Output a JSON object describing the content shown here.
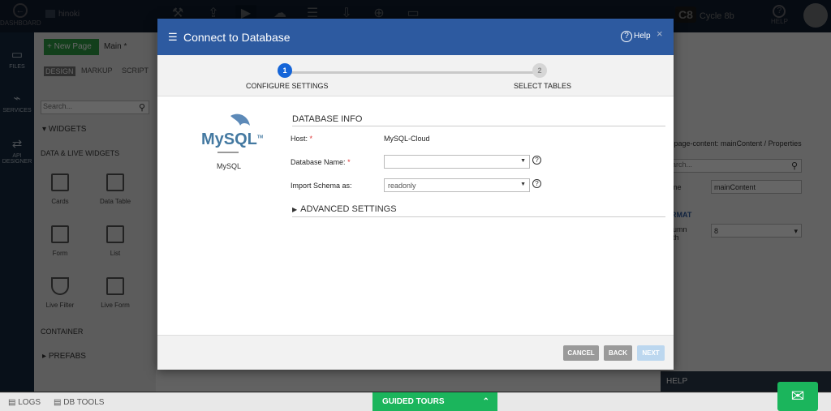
{
  "topbar": {
    "dashboard_label": "DASHBOARD",
    "project_name": "hinoki",
    "cycle_badge": "C8",
    "cycle_name": "Cycle 8b",
    "help_label": "HELP"
  },
  "leftnav": {
    "items": [
      {
        "label": "FILES",
        "icon": "folder-icon"
      },
      {
        "label": "SERVICES",
        "icon": "plug-icon"
      },
      {
        "label": "API DESIGNER",
        "icon": "api-icon"
      }
    ]
  },
  "widgets_panel": {
    "page_tab": "Main",
    "new_page_label": "New Page",
    "tabs": [
      "DESIGN",
      "MARKUP",
      "SCRIPT"
    ],
    "search_placeholder": "Search...",
    "widgets_header": "WIDGETS",
    "section_data_live": "DATA & LIVE WIDGETS",
    "items": [
      "Cards",
      "Data Table",
      "Form",
      "List",
      "Live Filter",
      "Live Form"
    ],
    "section_container": "CONTAINER",
    "prefabs_label": "PREFABS"
  },
  "right_panel": {
    "breadcrumb": "m-page-content: mainContent / Properties",
    "search_placeholder": "earch...",
    "name_label": "ame",
    "name_value": "mainContent",
    "format_header": "ORMAT",
    "column_width_label": "olumn idth",
    "column_width_value": "8",
    "help_label": "HELP"
  },
  "bottombar": {
    "logs_label": "LOGS",
    "dbtools_label": "DB TOOLS",
    "guided_tours_label": "GUIDED TOURS"
  },
  "modal": {
    "title": "Connect to Database",
    "help_label": "Help",
    "close_label": "×",
    "steps": [
      {
        "number": "1",
        "label": "CONFIGURE SETTINGS",
        "active": true
      },
      {
        "number": "2",
        "label": "SELECT TABLES",
        "active": false
      }
    ],
    "db_logo_text": "MySQL",
    "db_logo_sub": "TM",
    "db_name": "MySQL",
    "section_title": "DATABASE INFO",
    "host_label": "Host:",
    "host_value": "MySQL-Cloud",
    "database_name_label": "Database Name:",
    "database_name_value": "",
    "import_schema_label": "Import Schema as:",
    "import_schema_value": "readonly",
    "advanced_settings_label": "ADVANCED SETTINGS",
    "buttons": {
      "cancel": "CANCEL",
      "back": "BACK",
      "next": "NEXT"
    },
    "colors": {
      "header": "#2d5aa0",
      "step_active": "#1565d8",
      "button_gray": "#9a9a9a",
      "next_disabled": "#bcd7ef"
    }
  }
}
